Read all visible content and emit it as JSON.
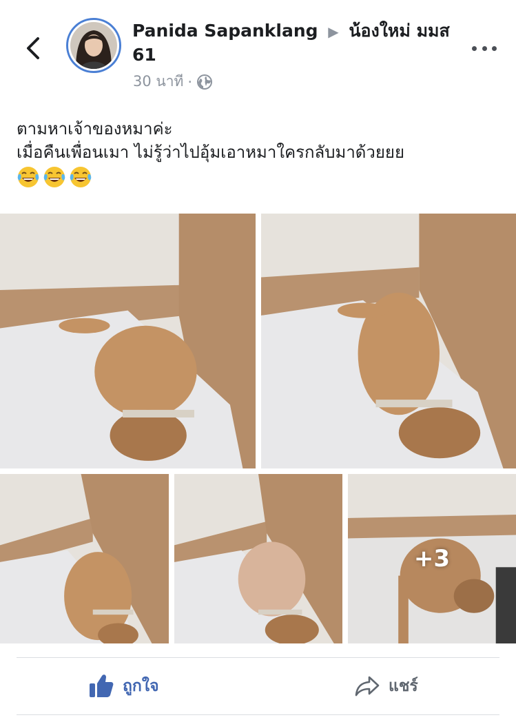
{
  "header": {
    "author": "Panida Sapanklang",
    "target_group": "น้องใหม่ มมส 61",
    "timestamp": "30 นาที",
    "separator": "·",
    "privacy_icon": "globe-icon",
    "back_icon": "chevron-left-icon",
    "more_icon": "more-dots-icon"
  },
  "post": {
    "line1": "ตามหาเจ้าของหมาค่ะ",
    "line2": "เมื่อคืนเพื่อนเมา ไม่รู้ว่าไปอุ้มเอาหมาใครกลับมาด้วยยย",
    "emojis": [
      "face-with-tears-of-joy",
      "face-with-tears-of-joy",
      "face-with-tears-of-joy"
    ]
  },
  "photos": {
    "count_shown": 5,
    "more_count": "+3"
  },
  "actions": {
    "like_label": "ถูกใจ",
    "share_label": "แชร์"
  },
  "colors": {
    "accent": "#4267b2",
    "avatar_ring": "#4a7fd4",
    "muted": "#8d949e"
  }
}
